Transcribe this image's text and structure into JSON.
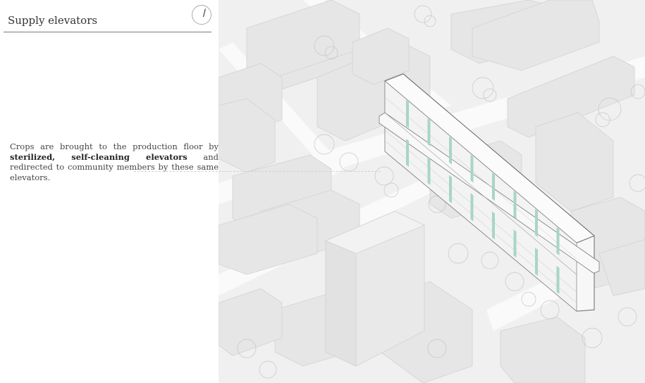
{
  "panel": {
    "title": "Supply elevators",
    "description": {
      "part1": "Crops are brought to the production floor by ",
      "bold": "sterilized, self-cleaning elevators",
      "part2": " and redirected to community members by these same elevators."
    }
  },
  "colors": {
    "elevator_accent": "#a8d5c6",
    "map_background": "#f0f0f0",
    "building_fill": "#e6e6e6",
    "rule": "#7a7a7a"
  },
  "icons": {
    "dial": "compass-dial-icon"
  }
}
